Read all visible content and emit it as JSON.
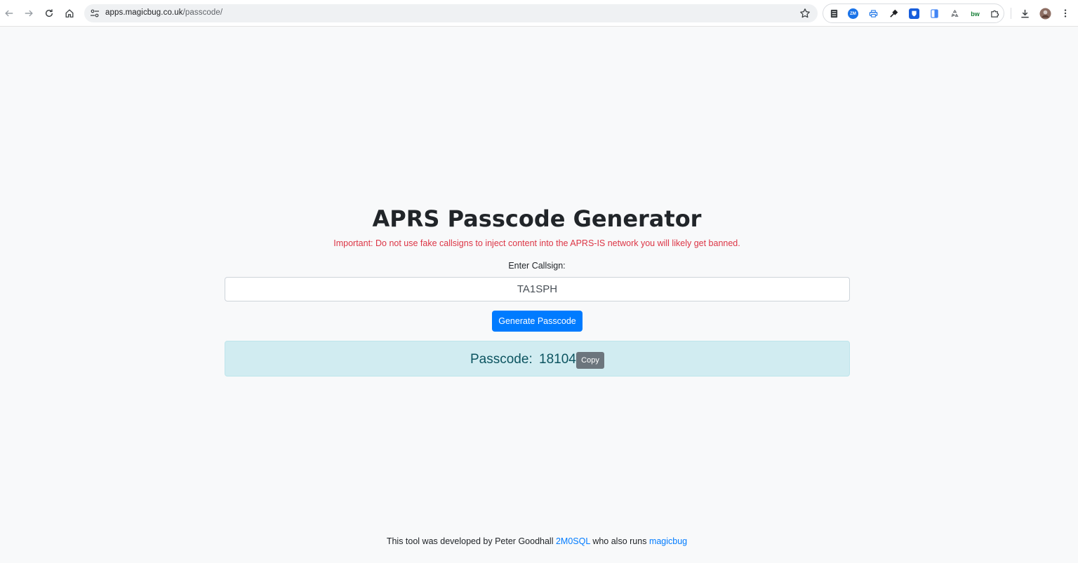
{
  "browser": {
    "url_host": "apps.magicbug.co.uk",
    "url_path": "/passcode/",
    "icons": {
      "back": "back-arrow-icon",
      "forward": "forward-arrow-icon",
      "reload": "reload-icon",
      "home": "home-icon",
      "site_info": "site-info-icon",
      "bookmark": "star-icon",
      "download": "download-icon",
      "menu": "kebab-menu-icon"
    },
    "extensions": [
      {
        "name": "extension-stack-icon",
        "color": "#3c4043"
      },
      {
        "name": "extension-zoom-icon",
        "color": "#1a73e8"
      },
      {
        "name": "extension-print-icon",
        "color": "#1a73e8"
      },
      {
        "name": "extension-eyedropper-icon",
        "color": "#202124"
      },
      {
        "name": "extension-bitwarden-icon",
        "color": "#175ddc"
      },
      {
        "name": "extension-reader-icon",
        "color": "#4285f4"
      },
      {
        "name": "extension-recycle-icon",
        "color": "#5f6368"
      },
      {
        "name": "extension-bw-icon",
        "color": "#188038"
      },
      {
        "name": "extensions-puzzle-icon",
        "color": "#3c4043"
      }
    ]
  },
  "page": {
    "title": "APRS Passcode Generator",
    "warning": "Important: Do not use fake callsigns to inject content into the APRS-IS network you will likely get banned.",
    "callsign_label": "Enter Callsign:",
    "callsign_value": "TA1SPH",
    "generate_button": "Generate Passcode",
    "result_label": "Passcode:",
    "result_value": "18104",
    "copy_button": "Copy"
  },
  "footer": {
    "text_before": "This tool was developed by Peter Goodhall",
    "link1": "2M0SQL",
    "text_middle": "who also runs",
    "link2": "magicbug"
  },
  "colors": {
    "primary": "#007bff",
    "danger": "#dc3545",
    "info_bg": "#d1ecf1",
    "info_text": "#0c5460",
    "secondary": "#6c757d"
  }
}
